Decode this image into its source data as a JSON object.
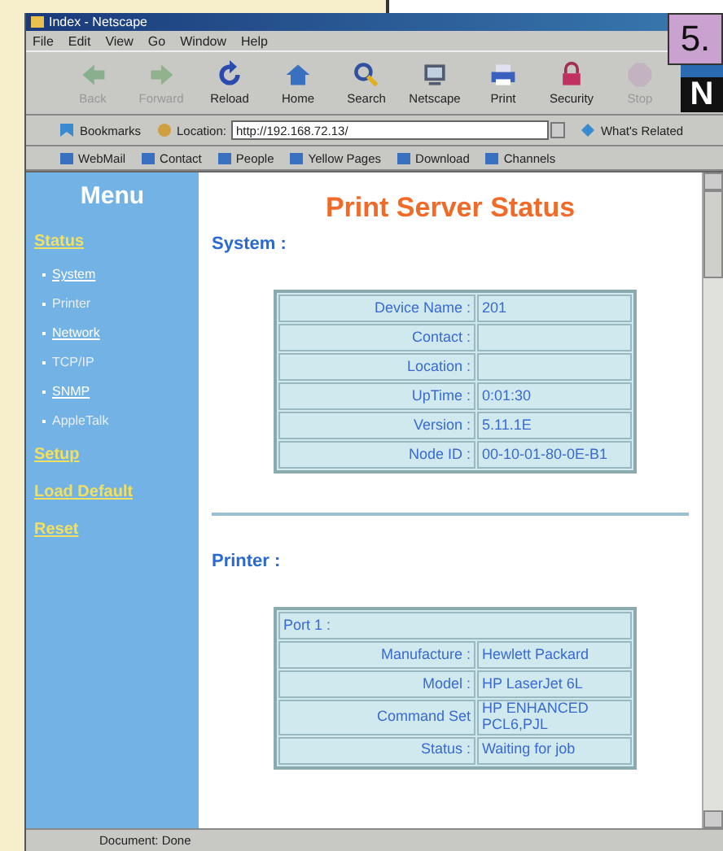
{
  "badge": "5.",
  "window": {
    "title": "Index - Netscape"
  },
  "menu_bar": [
    "File",
    "Edit",
    "View",
    "Go",
    "Window",
    "Help"
  ],
  "toolbar": [
    {
      "label": "Back",
      "disabled": true
    },
    {
      "label": "Forward",
      "disabled": true
    },
    {
      "label": "Reload",
      "disabled": false
    },
    {
      "label": "Home",
      "disabled": false
    },
    {
      "label": "Search",
      "disabled": false
    },
    {
      "label": "Netscape",
      "disabled": false
    },
    {
      "label": "Print",
      "disabled": false
    },
    {
      "label": "Security",
      "disabled": false
    },
    {
      "label": "Stop",
      "disabled": true
    }
  ],
  "logo": "N",
  "location_bar": {
    "bookmarks": "Bookmarks",
    "location_label": "Location:",
    "url": "http://192.168.72.13/",
    "related": "What's Related"
  },
  "personal_toolbar": [
    "WebMail",
    "Contact",
    "People",
    "Yellow Pages",
    "Download",
    "Channels"
  ],
  "sidebar": {
    "title": "Menu",
    "items": [
      {
        "label": "Status",
        "kind": "section"
      },
      {
        "label": "System",
        "kind": "sub",
        "visited": false
      },
      {
        "label": "Printer",
        "kind": "sub",
        "visited": true
      },
      {
        "label": "Network",
        "kind": "sub",
        "visited": false
      },
      {
        "label": "TCP/IP",
        "kind": "sub",
        "visited": true
      },
      {
        "label": "SNMP",
        "kind": "sub",
        "visited": false
      },
      {
        "label": "AppleTalk",
        "kind": "sub",
        "visited": true
      },
      {
        "label": "Setup",
        "kind": "section"
      },
      {
        "label": "Load Default",
        "kind": "section"
      },
      {
        "label": "Reset",
        "kind": "section"
      }
    ]
  },
  "page": {
    "title": "Print Server Status",
    "system": {
      "heading": "System :",
      "rows": [
        {
          "label": "Device Name :",
          "value": "201"
        },
        {
          "label": "Contact :",
          "value": ""
        },
        {
          "label": "Location :",
          "value": ""
        },
        {
          "label": "UpTime :",
          "value": "0:01:30"
        },
        {
          "label": "Version :",
          "value": "5.11.1E"
        },
        {
          "label": "Node ID :",
          "value": "00-10-01-80-0E-B1"
        }
      ]
    },
    "printer": {
      "heading": "Printer :",
      "port": "Port 1 :",
      "rows": [
        {
          "label": "Manufacture :",
          "value": "Hewlett Packard"
        },
        {
          "label": "Model :",
          "value": "HP LaserJet 6L"
        },
        {
          "label": "Command Set",
          "value": "HP ENHANCED PCL6,PJL"
        },
        {
          "label": "Status :",
          "value": "Waiting for job"
        }
      ]
    }
  },
  "status_bar": "Document: Done"
}
